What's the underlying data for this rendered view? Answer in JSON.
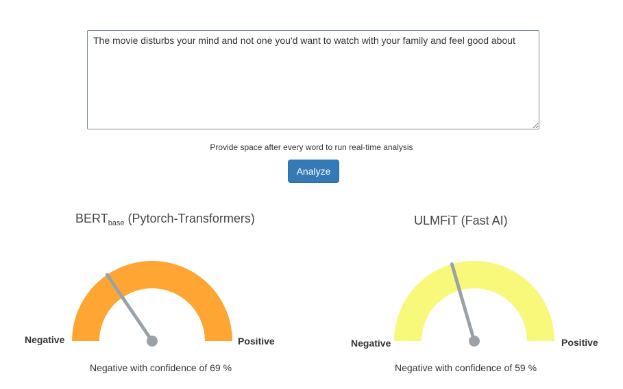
{
  "input": {
    "text": "The movie disturbs your mind and not one you'd want to watch with your family and feel good about"
  },
  "hint": "Provide space after every word to run real-time analysis",
  "analyze_label": "Analyze",
  "models": [
    {
      "title_main": "BERT",
      "title_sub": "base",
      "title_rest": " (Pytorch-Transformers)",
      "negative_label": "Negative",
      "positive_label": "Positive",
      "result": "Negative with confidence of 69 %",
      "sentiment": "Negative",
      "confidence_pct": 69,
      "gauge_color": "#ffa533"
    },
    {
      "title_main": "ULMFiT (Fast AI)",
      "negative_label": "Negative",
      "positive_label": "Positive",
      "result": "Negative with confidence of 59 %",
      "sentiment": "Negative",
      "confidence_pct": 59,
      "gauge_color": "#f8f87a"
    }
  ],
  "colors": {
    "button": "#337ab7",
    "needle": "#9aa2a8"
  }
}
